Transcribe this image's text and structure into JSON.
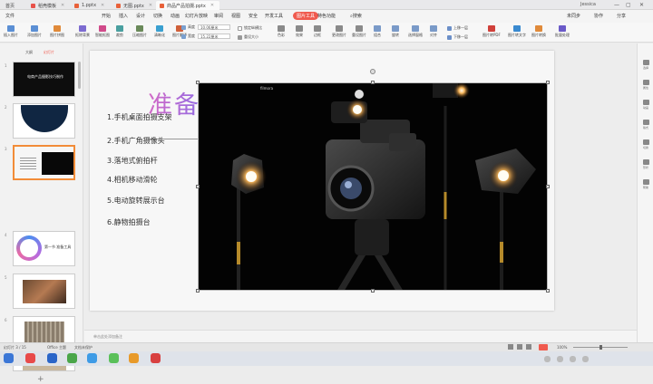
{
  "titlebar": {
    "home_label": "首页",
    "tabs": [
      {
        "label": "稻壳模板",
        "color": "#e8524a",
        "active": false
      },
      {
        "label": "1.pptx",
        "color": "#e8613a",
        "active": false
      },
      {
        "label": "无图.pptx",
        "color": "#e8613a",
        "active": false
      },
      {
        "label": "商品产品拍摄.pptx",
        "color": "#e8613a",
        "active": true
      }
    ],
    "user_label": "Jessica"
  },
  "menubar": {
    "file_label": "文件",
    "items": [
      "开始",
      "插入",
      "设计",
      "切换",
      "动画",
      "幻灯片放映",
      "审阅",
      "视图",
      "安全",
      "开发工具",
      "图片工具",
      "特色功能"
    ],
    "selected_label": "图片工具",
    "search_label": "搜索",
    "right_items": [
      "未同步",
      "协作",
      "分享"
    ]
  },
  "ribbon": {
    "big_buttons": [
      "插入图片",
      "添加图片",
      "图片拼图",
      "抠除背景",
      "智能抠图",
      "裁剪",
      "压缩图片",
      "清晰化",
      "图片翻译"
    ],
    "height_label": "高度",
    "height_value": "10.06厘米",
    "width_label": "宽度",
    "width_value": "15.22厘米",
    "lock_label": "锁定纵横比",
    "reset_label": "重设大小",
    "mid_buttons": [
      "色彩",
      "效果",
      "边框",
      "更改图片",
      "重设图片"
    ],
    "align_buttons": [
      "组合",
      "旋转",
      "选择窗格",
      "对齐"
    ],
    "order_buttons": [
      "上移一层",
      "下移一层"
    ],
    "right_buttons": [
      "图片转PDF",
      "图片转文字",
      "图片转换",
      "批量处理"
    ]
  },
  "thumbs": {
    "tab_outline": "大纲",
    "tab_slides": "幻灯片",
    "selected_index": 3,
    "slides": [
      {
        "num": "1",
        "caption": "电商产品摄影技巧制作"
      },
      {
        "num": "2",
        "caption": ""
      },
      {
        "num": "3",
        "caption": ""
      },
      {
        "num": "4",
        "caption": "第一节 准备工具"
      },
      {
        "num": "5",
        "caption": ""
      },
      {
        "num": "6",
        "caption": ""
      },
      {
        "num": "7",
        "caption": ""
      }
    ]
  },
  "slide": {
    "title": "准备工具",
    "items": [
      "1.手机桌面拍摄支架",
      "2.手机广角摄像头",
      "3.落地式俯拍杆",
      "4.相机移动滑轮",
      "5.电动旋转展示台",
      "6.静物拍摄台"
    ],
    "photo_watermark": "filmora"
  },
  "rightpanel": {
    "items": [
      "选择",
      "属性",
      "动画",
      "版式",
      "切换",
      "形状",
      "帮助"
    ]
  },
  "notes": {
    "placeholder": "单击此处添加备注"
  },
  "status": {
    "slide_info": "幻灯片 3 / 15",
    "theme": "Office 主题",
    "doc_protect": "文档未保护",
    "zoom": "100%"
  },
  "colors": {
    "accent": "#f05a4e",
    "selection": "#f28c38"
  }
}
